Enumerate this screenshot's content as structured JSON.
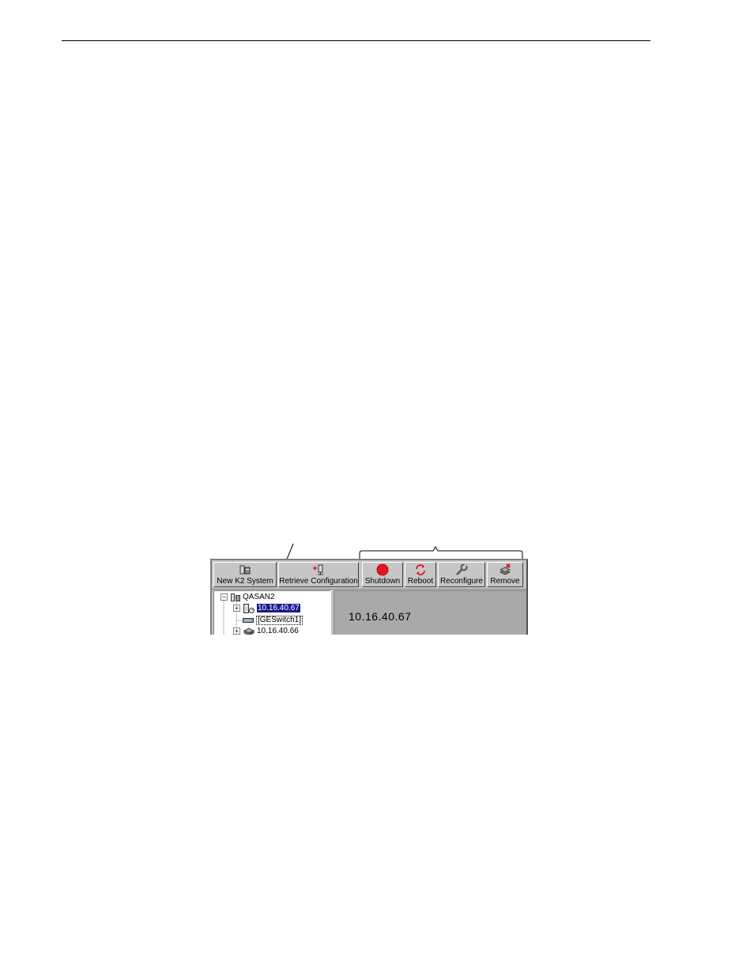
{
  "toolbar": {
    "buttons": [
      {
        "label": "New K2 System",
        "icon": "new-system-icon"
      },
      {
        "label": "Retrieve Configuration",
        "icon": "retrieve-config-icon"
      },
      {
        "label": "Shutdown",
        "icon": "shutdown-icon",
        "color": "#e8141e"
      },
      {
        "label": "Reboot",
        "icon": "reboot-icon",
        "color": "#e8141e"
      },
      {
        "label": "Reconfigure",
        "icon": "wrench-icon"
      },
      {
        "label": "Remove",
        "icon": "remove-icon"
      }
    ]
  },
  "tree": {
    "root": "QASAN2",
    "items": [
      {
        "label": "10.16.40.67",
        "selected": true,
        "icon": "server-icon"
      },
      {
        "label": "[GESwitch1]",
        "icon": "switch-icon"
      },
      {
        "label": "10.16.40.66",
        "icon": "storage-icon"
      }
    ]
  },
  "detail": {
    "title": "10.16.40.67"
  },
  "colors": {
    "selection": "#1a1a8c",
    "panel": "#c6c6c6",
    "detail_bg": "#a9a9a9"
  }
}
